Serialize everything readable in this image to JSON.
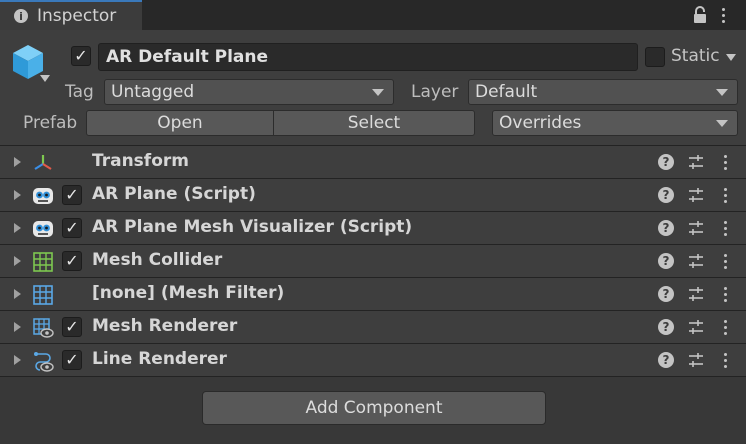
{
  "tab": {
    "label": "Inspector",
    "icon": "info-icon"
  },
  "header": {
    "object_icon": "cube-icon",
    "active": true,
    "name": "AR Default Plane",
    "static_label": "Static",
    "static_checked": false,
    "tag_label": "Tag",
    "tag_value": "Untagged",
    "layer_label": "Layer",
    "layer_value": "Default",
    "prefab_label": "Prefab",
    "prefab_open": "Open",
    "prefab_select": "Select",
    "prefab_overrides": "Overrides"
  },
  "components": [
    {
      "name": "Transform",
      "icon": "transform-axes-icon",
      "has_checkbox": false,
      "enabled": null
    },
    {
      "name": "AR Plane (Script)",
      "icon": "script-icon",
      "has_checkbox": true,
      "enabled": true
    },
    {
      "name": "AR Plane Mesh Visualizer (Script)",
      "icon": "script-icon",
      "has_checkbox": true,
      "enabled": true
    },
    {
      "name": "Mesh Collider",
      "icon": "mesh-collider-icon",
      "has_checkbox": true,
      "enabled": true
    },
    {
      "name": "[none] (Mesh Filter)",
      "icon": "mesh-filter-icon",
      "has_checkbox": false,
      "enabled": null
    },
    {
      "name": "Mesh Renderer",
      "icon": "mesh-renderer-icon",
      "has_checkbox": true,
      "enabled": true
    },
    {
      "name": "Line Renderer",
      "icon": "line-renderer-icon",
      "has_checkbox": true,
      "enabled": true
    }
  ],
  "add_component_label": "Add Component",
  "colors": {
    "accent_tab": "#3a79bb",
    "background": "#383838",
    "cube": "#4ab0e8",
    "collider_green": "#7ec850"
  }
}
